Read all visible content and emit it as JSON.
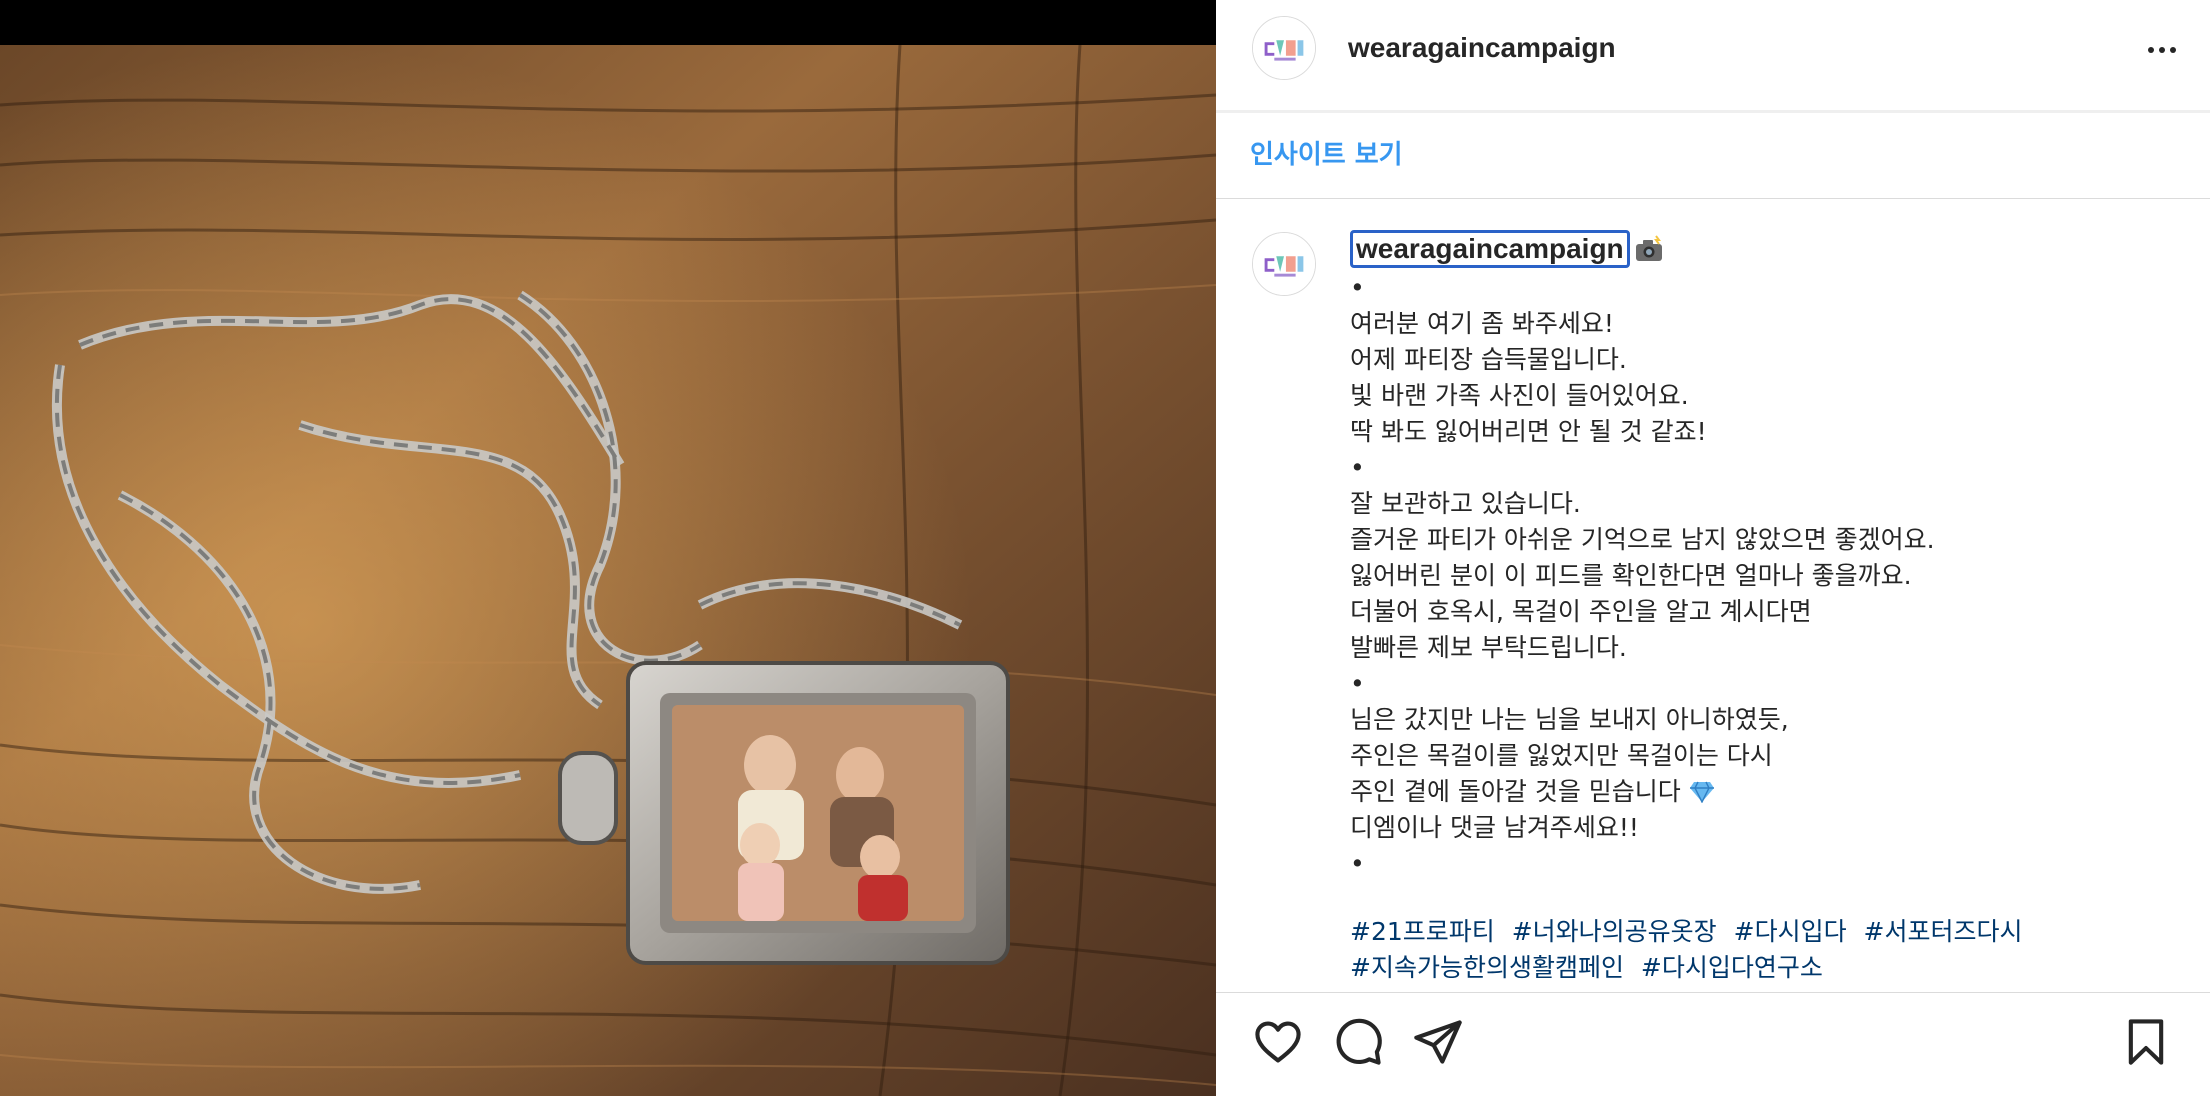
{
  "post": {
    "username": "wearagaincampaign",
    "more_label": "more-options",
    "avatar_text": "다시입다",
    "insight_link": "인사이트 보기",
    "caption": {
      "username": "wearagaincampaign",
      "lines": [
        "•",
        "여러분 여기 좀 봐주세요!",
        "어제 파티장 습득물입니다.",
        "빛 바랜 가족 사진이 들어있어요.",
        "딱 봐도 잃어버리면 안 될 것 같죠!",
        "•",
        "잘 보관하고 있습니다.",
        "즐거운 파티가 아쉬운 기억으로 남지 않았으면 좋겠어요.",
        "잃어버린 분이 이 피드를 확인한다면 얼마나 좋을까요.",
        "더불어 호옥시, 목걸이 주인을 알고 계시다면",
        "발빠른 제보 부탁드립니다.",
        "•",
        "님은 갔지만 나는 님을 보내지 아니하였듯,",
        "주인은 목걸이를 잃었지만 목걸이는 다시",
        "주인 곁에 돌아갈 것을 믿습니다",
        "디엠이나 댓글 남겨주세요!!",
        "•"
      ],
      "hashtags": [
        "#21프로파티",
        "#너와나의공유옷장",
        "#다시입다",
        "#서포터즈다시",
        "#지속가능한의생활캠페인",
        "#다시입다연구소"
      ]
    }
  },
  "icons": {
    "header_more": "more-horizontal-icon",
    "caption_emoji": "camera-flash-icon",
    "gem": "gem-icon",
    "like": "heart-icon",
    "comment": "comment-icon",
    "share": "send-icon",
    "save": "bookmark-icon"
  },
  "colors": {
    "link_blue": "#3797f0",
    "hashtag_blue": "#00376b",
    "focus_outline": "#2a62c8",
    "text": "#262626",
    "divider": "#dbdbdb"
  }
}
